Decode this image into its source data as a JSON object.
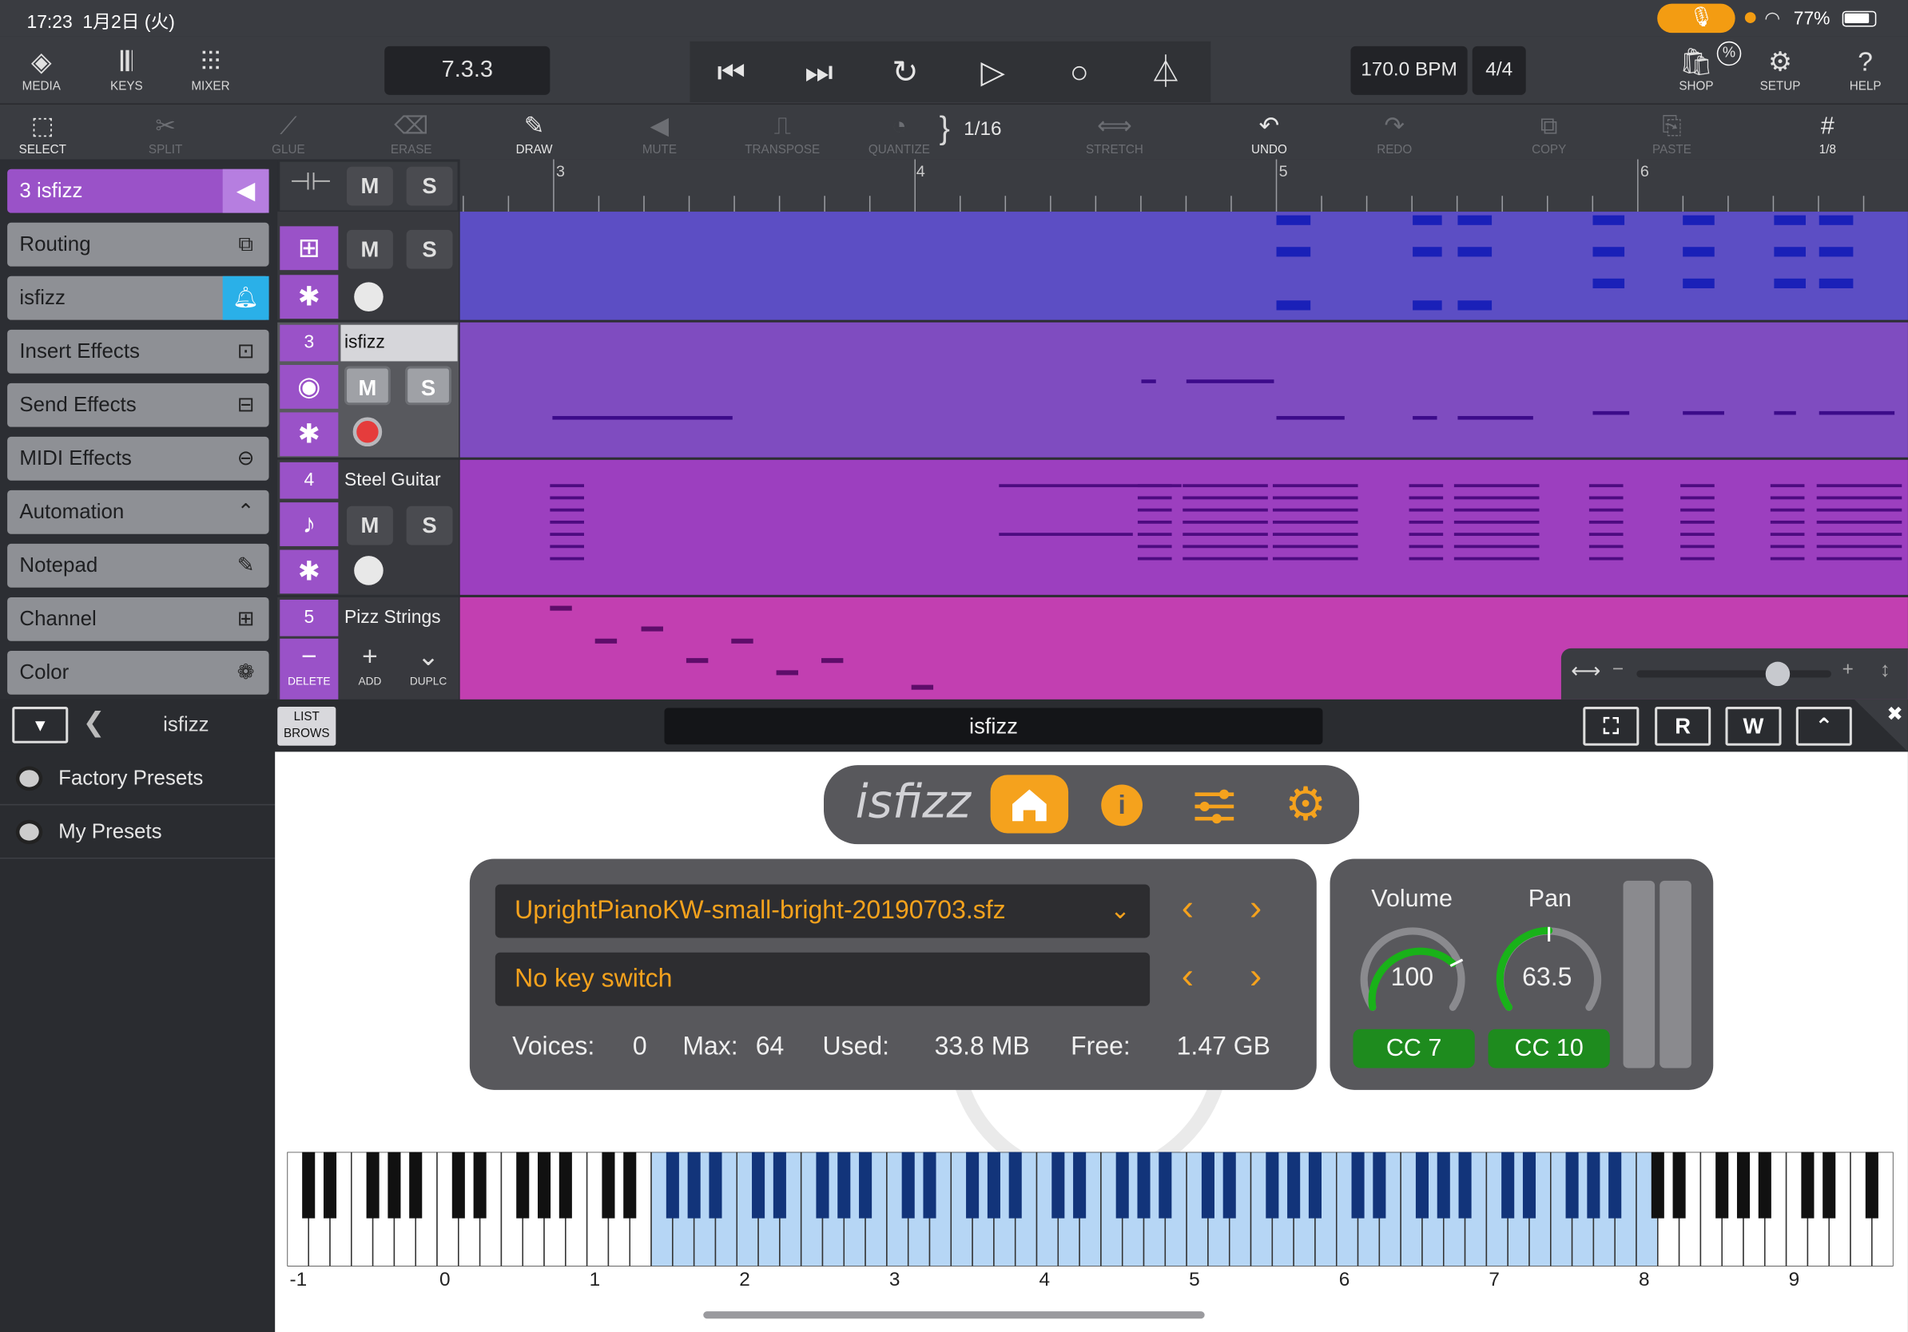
{
  "status_bar": {
    "time": "17:23",
    "date": "1月2日 (火)",
    "battery": "77%",
    "mic_icon": "microphone-icon"
  },
  "topbar": {
    "media": "MEDIA",
    "keys": "KEYS",
    "mixer": "MIXER",
    "position": "7.3.3",
    "bpm": "170.0 BPM",
    "time_signature": "4/4",
    "shop": "SHOP",
    "setup": "SETUP",
    "help": "HELP"
  },
  "editbar": {
    "select": "SELECT",
    "split": "SPLIT",
    "glue": "GLUE",
    "erase": "ERASE",
    "draw": "DRAW",
    "mute": "MUTE",
    "transpose": "TRANSPOSE",
    "quantize": "QUANTIZE",
    "quantize_value": "1/16",
    "stretch": "STRETCH",
    "undo": "UNDO",
    "redo": "REDO",
    "copy": "COPY",
    "paste": "PASTE",
    "grid": "1/8"
  },
  "left_panel": {
    "header": "3  isfizz",
    "items": [
      "Routing",
      "isfizz",
      "Insert Effects",
      "Send Effects",
      "MIDI Effects",
      "Automation",
      "Notepad",
      "Channel",
      "Color"
    ]
  },
  "ruler": {
    "marks": [
      "3",
      "4",
      "5",
      "6"
    ]
  },
  "tracks": [
    {
      "number": "3",
      "name": "isfizz",
      "mute": "M",
      "solo": "S"
    },
    {
      "number": "4",
      "name": "Steel Guitar",
      "mute": "M",
      "solo": "S"
    },
    {
      "number": "5",
      "name": "Pizz Strings"
    }
  ],
  "track_header_top": {
    "mute": "M",
    "solo": "S"
  },
  "track_actions": {
    "delete": "DELETE",
    "add": "ADD",
    "duplicate": "DUPLC"
  },
  "plugin_bar": {
    "current": "isfizz",
    "list_brows_1": "LIST",
    "list_brows_2": "BROWS",
    "title": "isfizz",
    "r_button": "R",
    "w_button": "W"
  },
  "presets": [
    "Factory Presets",
    "My Presets"
  ],
  "sfizz": {
    "logo": "isfizz",
    "file": "UprightPianoKW-small-bright-20190703.sfz",
    "keyswitch": "No key switch",
    "voices_label": "Voices:",
    "voices": "0",
    "max_label": "Max:",
    "max": "64",
    "used_label": "Used:",
    "used": "33.8 MB",
    "free_label": "Free:",
    "free": "1.47 GB",
    "volume_label": "Volume",
    "volume": "100",
    "volume_cc": "CC 7",
    "pan_label": "Pan",
    "pan": "63.5",
    "pan_cc": "CC 10",
    "accent": "#f5a21d"
  },
  "keyboard": {
    "octaves": [
      "-1",
      "0",
      "1",
      "2",
      "3",
      "4",
      "5",
      "6",
      "7",
      "8",
      "9"
    ]
  }
}
